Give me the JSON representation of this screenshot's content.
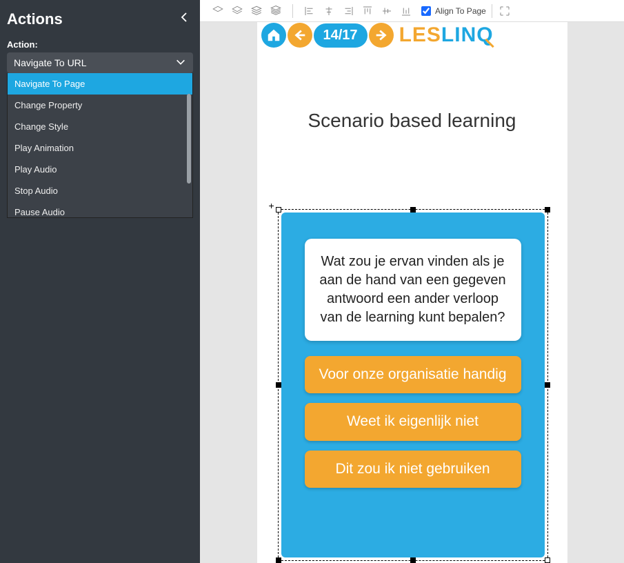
{
  "sidebar": {
    "title": "Actions",
    "action_label": "Action:",
    "selected_action": "Navigate To URL",
    "dropdown": [
      "Navigate To Page",
      "Change Property",
      "Change Style",
      "Play Animation",
      "Play Audio",
      "Stop Audio",
      "Pause Audio"
    ]
  },
  "toolbar": {
    "align_label": "Align To Page",
    "align_checked": true
  },
  "page": {
    "counter": "14/17",
    "logo_part1": "LES",
    "logo_part2": "LIN",
    "logo_q": "Q",
    "title": "Scenario based learning",
    "question": "Wat zou je ervan vinden als je aan de hand van een gegeven antwoord een ander verloop van de learning kunt bepalen?",
    "answers": [
      "Voor onze organisatie handig",
      "Weet ik eigenlijk niet",
      "Dit zou ik niet gebruiken"
    ]
  }
}
